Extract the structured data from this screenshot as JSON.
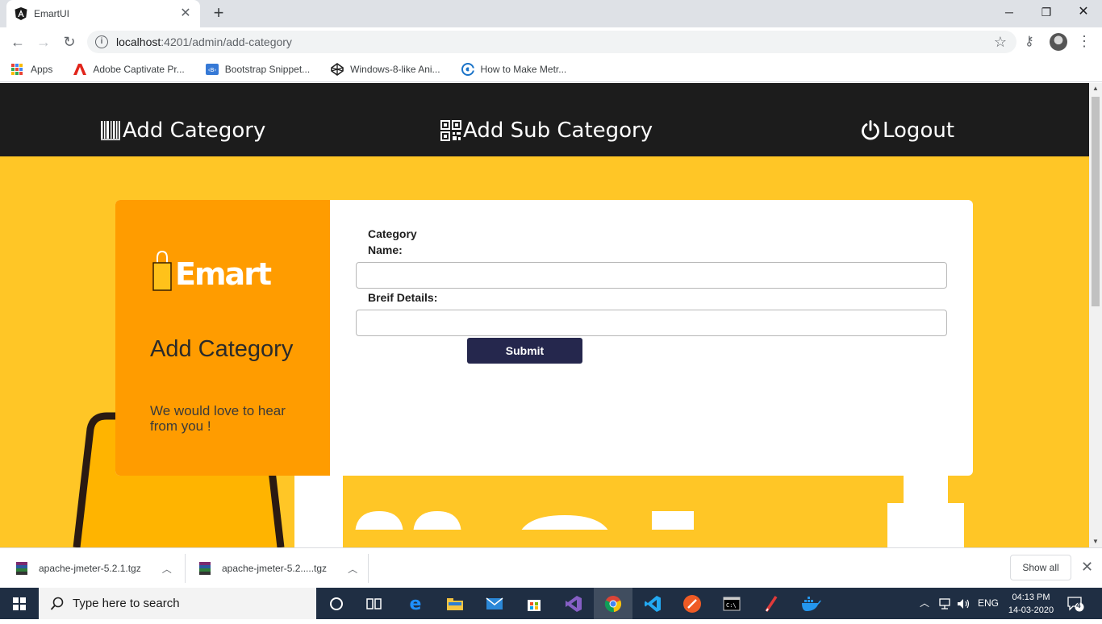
{
  "browser": {
    "tab_title": "EmartUI",
    "url_host": "localhost",
    "url_path": ":4201/admin/add-category",
    "bookmarks": [
      {
        "label": "Apps"
      },
      {
        "label": "Adobe Captivate Pr..."
      },
      {
        "label": "Bootstrap Snippet..."
      },
      {
        "label": "Windows-8-like Ani..."
      },
      {
        "label": "How to Make Metr..."
      }
    ]
  },
  "nav": {
    "add_category": "Add Category",
    "add_sub_category": "Add Sub Category",
    "logout": "Logout"
  },
  "card": {
    "logo_text": "Emart",
    "title": "Add Category",
    "subtitle": "We would love to hear from you !",
    "category_name_label": "Category Name:",
    "brief_details_label": "Breif Details:",
    "category_name_value": "",
    "brief_details_value": "",
    "submit_label": "Submit"
  },
  "downloads": {
    "items": [
      {
        "name": "apache-jmeter-5.2.1.tgz"
      },
      {
        "name": "apache-jmeter-5.2.....tgz"
      }
    ],
    "show_all": "Show all"
  },
  "taskbar": {
    "search_placeholder": "Type here to search",
    "language": "ENG",
    "time": "04:13 PM",
    "date": "14-03-2020",
    "notification_count": "4"
  },
  "colors": {
    "page_bg": "#ffc626",
    "navbar": "#1c1c1c",
    "card_left": "#ff9c00",
    "submit": "#25274d"
  }
}
